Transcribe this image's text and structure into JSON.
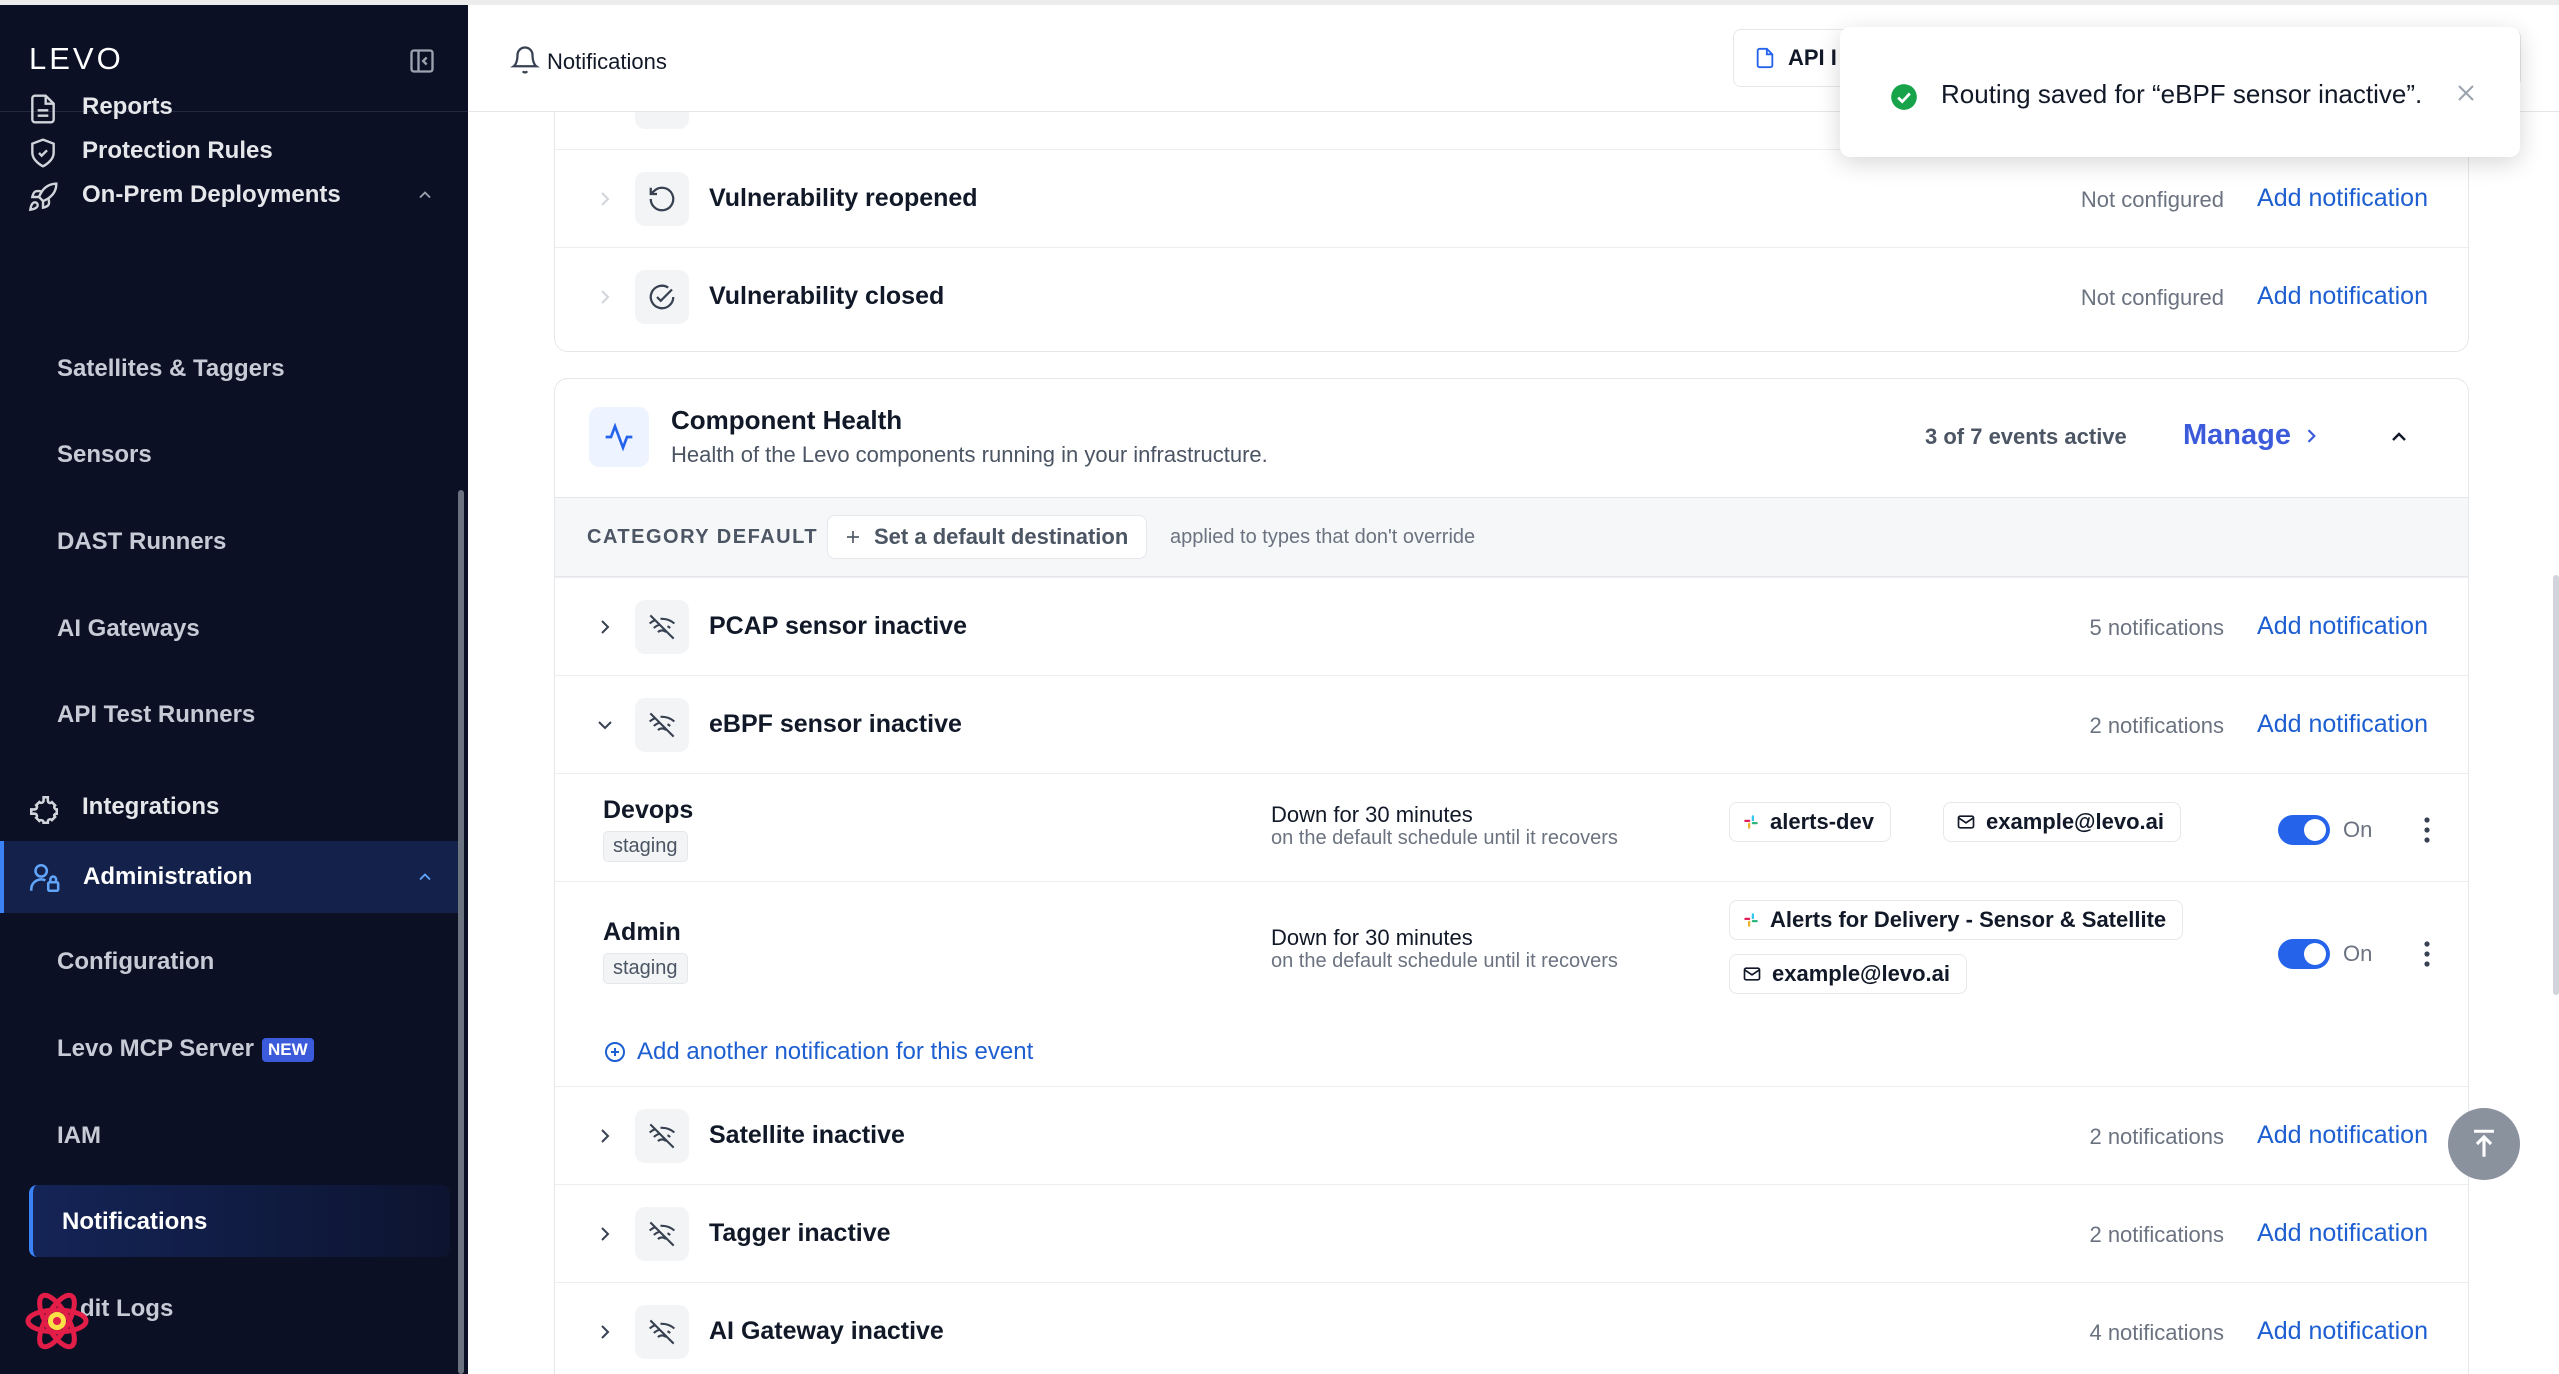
{
  "sidebar": {
    "logo": "LEVO",
    "items": [
      {
        "label": "Reports"
      },
      {
        "label": "Protection Rules"
      },
      {
        "label": "On-Prem Deployments"
      },
      {
        "label": "Integrations"
      },
      {
        "label": "Administration"
      }
    ],
    "onprem_sub": [
      "Satellites & Taggers",
      "Sensors",
      "DAST Runners",
      "AI Gateways",
      "API Test Runners"
    ],
    "admin_sub": {
      "configuration": "Configuration",
      "mcp": "Levo MCP Server",
      "mcp_badge": "NEW",
      "iam": "IAM",
      "notifications": "Notifications",
      "audit": "dit Logs"
    }
  },
  "topbar": {
    "title": "Notifications",
    "api_button": "API I"
  },
  "toast": {
    "message": "Routing saved for “eBPF sensor inactive”."
  },
  "vuln_card": {
    "rows": [
      {
        "name": "Vulnerability reopened",
        "status": "Not configured",
        "action": "Add notification"
      },
      {
        "name": "Vulnerability closed",
        "status": "Not configured",
        "action": "Add notification"
      }
    ]
  },
  "health_card": {
    "title": "Component Health",
    "subtitle": "Health of the Levo components running in your infrastructure.",
    "active_count": "3 of 7 events active",
    "manage": "Manage",
    "category_default": "CATEGORY DEFAULT",
    "set_default": "Set a default destination",
    "default_note": "applied to types that don't override",
    "events": [
      {
        "name": "PCAP sensor inactive",
        "count": "5 notifications",
        "action": "Add notification"
      },
      {
        "name": "eBPF sensor inactive",
        "count": "2 notifications",
        "action": "Add notification"
      },
      {
        "name": "Satellite inactive",
        "count": "2 notifications",
        "action": "Add notification"
      },
      {
        "name": "Tagger inactive",
        "count": "2 notifications",
        "action": "Add notification"
      },
      {
        "name": "AI Gateway inactive",
        "count": "4 notifications",
        "action": "Add notification"
      }
    ],
    "routes": [
      {
        "name": "Devops",
        "env": "staging",
        "cond1": "Down for 30 minutes",
        "cond2": "on the default schedule until it recovers",
        "slack": "alerts-dev",
        "email": "example@levo.ai",
        "state": "On"
      },
      {
        "name": "Admin",
        "env": "staging",
        "cond1": "Down for 30 minutes",
        "cond2": "on the default schedule until it recovers",
        "slack": "Alerts for Delivery  -  Sensor & Satellite",
        "email": "example@levo.ai",
        "state": "On"
      }
    ],
    "add_another": "Add another notification for this event"
  },
  "colors": {
    "accent": "#1d5fd1",
    "sidebar_bg": "#0b1024",
    "toggle_on": "#2563eb",
    "success": "#16a34a"
  }
}
